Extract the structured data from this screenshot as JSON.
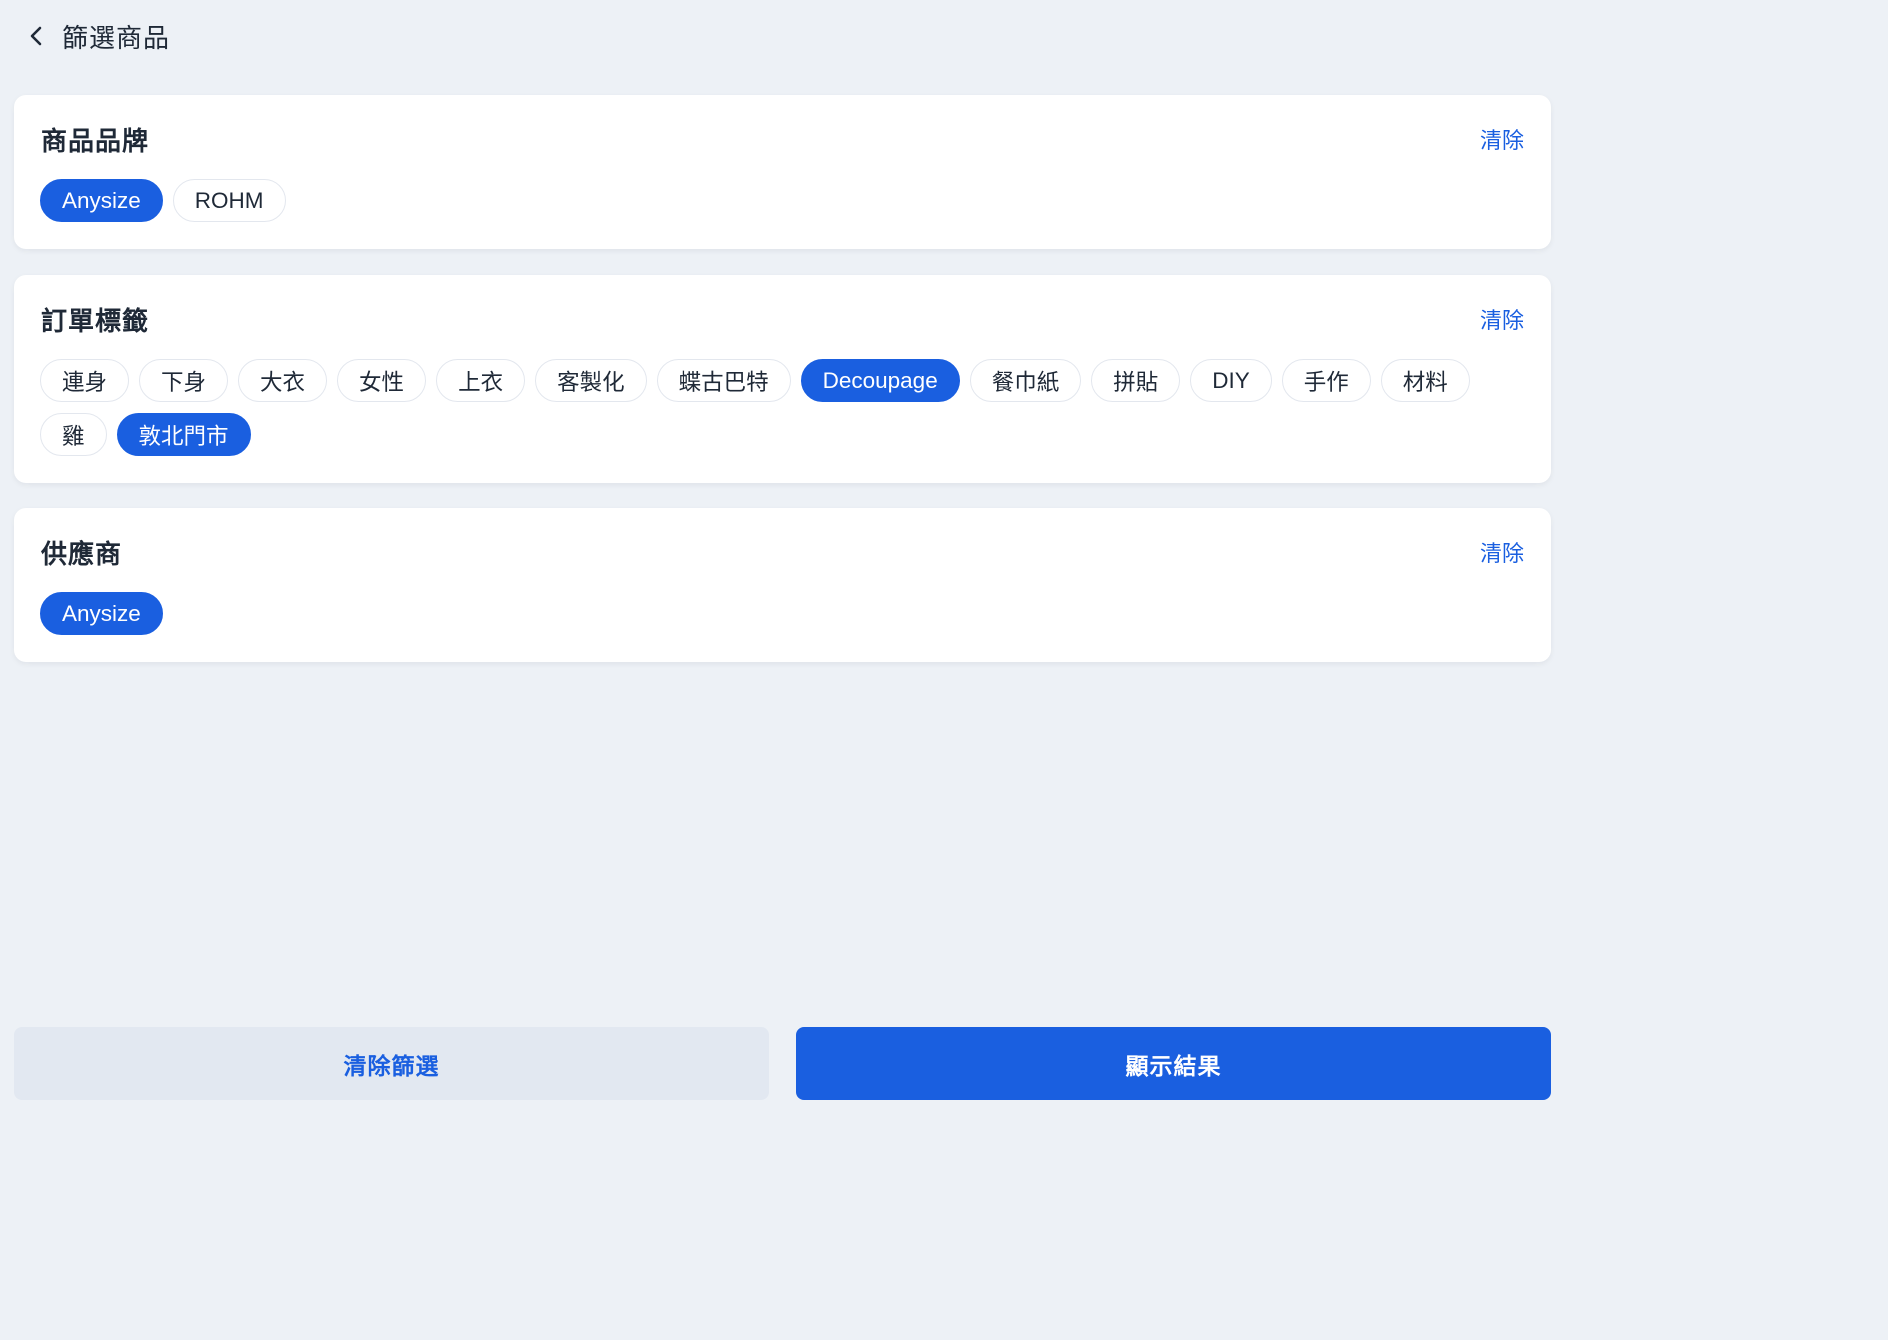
{
  "header": {
    "title": "篩選商品"
  },
  "sections": [
    {
      "title": "商品品牌",
      "clear_label": "清除",
      "tags": [
        {
          "label": "Anysize",
          "selected": true
        },
        {
          "label": "ROHM",
          "selected": false
        }
      ]
    },
    {
      "title": "訂單標籤",
      "clear_label": "清除",
      "tags": [
        {
          "label": "連身",
          "selected": false
        },
        {
          "label": "下身",
          "selected": false
        },
        {
          "label": "大衣",
          "selected": false
        },
        {
          "label": "女性",
          "selected": false
        },
        {
          "label": "上衣",
          "selected": false
        },
        {
          "label": "客製化",
          "selected": false
        },
        {
          "label": "蝶古巴特",
          "selected": false
        },
        {
          "label": "Decoupage",
          "selected": true
        },
        {
          "label": "餐巾紙",
          "selected": false
        },
        {
          "label": "拼貼",
          "selected": false
        },
        {
          "label": "DIY",
          "selected": false
        },
        {
          "label": "手作",
          "selected": false
        },
        {
          "label": "材料",
          "selected": false
        },
        {
          "label": "雞",
          "selected": false
        },
        {
          "label": "敦北門市",
          "selected": true
        }
      ]
    },
    {
      "title": "供應商",
      "clear_label": "清除",
      "tags": [
        {
          "label": "Anysize",
          "selected": true
        }
      ]
    }
  ],
  "footer": {
    "clear_all_label": "清除篩選",
    "show_results_label": "顯示結果"
  },
  "colors": {
    "accent": "#1a5fe0",
    "background": "#edf1f6",
    "card": "#ffffff",
    "secondary_button": "#e2e8f1"
  },
  "icons": {
    "back": "chevron-left-icon"
  }
}
